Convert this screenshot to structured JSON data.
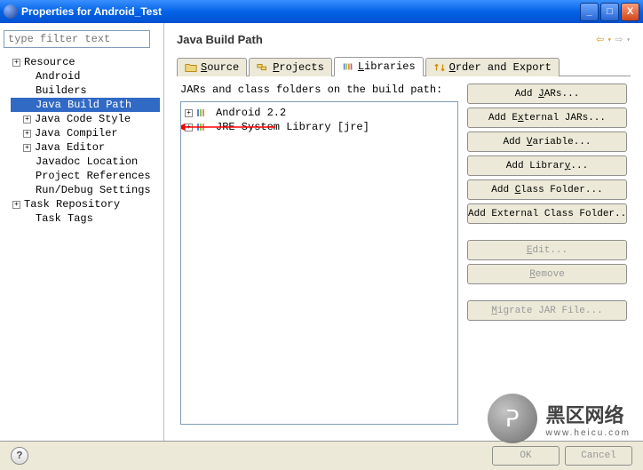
{
  "window": {
    "title": "Properties for Android_Test"
  },
  "filter": {
    "placeholder": "type filter text"
  },
  "nav": {
    "items": [
      {
        "label": "Resource",
        "expandable": true
      },
      {
        "label": "Android",
        "expandable": false,
        "child": true
      },
      {
        "label": "Builders",
        "expandable": false,
        "child": true
      },
      {
        "label": "Java Build Path",
        "expandable": false,
        "child": true,
        "selected": true
      },
      {
        "label": "Java Code Style",
        "expandable": true,
        "child": true
      },
      {
        "label": "Java Compiler",
        "expandable": true,
        "child": true
      },
      {
        "label": "Java Editor",
        "expandable": true,
        "child": true
      },
      {
        "label": "Javadoc Location",
        "expandable": false,
        "child": true
      },
      {
        "label": "Project References",
        "expandable": false,
        "child": true
      },
      {
        "label": "Run/Debug Settings",
        "expandable": false,
        "child": true
      },
      {
        "label": "Task Repository",
        "expandable": true
      },
      {
        "label": "Task Tags",
        "expandable": false,
        "child": true
      }
    ]
  },
  "page": {
    "title": "Java Build Path"
  },
  "tabs": {
    "source": "Source",
    "projects": "Projects",
    "libraries": "Libraries",
    "order": "Order and Export"
  },
  "libs": {
    "desc": "JARs and class folders on the build path:",
    "items": [
      {
        "label": "Android 2.2"
      },
      {
        "label": "JRE System Library [jre]"
      }
    ]
  },
  "buttons": {
    "add_jars": "Add JARs...",
    "add_ext_jars": "Add External JARs...",
    "add_variable": "Add Variable...",
    "add_library": "Add Library...",
    "add_class_folder": "Add Class Folder...",
    "add_ext_class_folder": "Add External Class Folder...",
    "edit": "Edit...",
    "remove": "Remove",
    "migrate": "Migrate JAR File..."
  },
  "footer": {
    "ok": "OK",
    "cancel": "Cancel"
  },
  "watermark": {
    "text": "黑区网络",
    "sub": "www.heicu.com"
  }
}
